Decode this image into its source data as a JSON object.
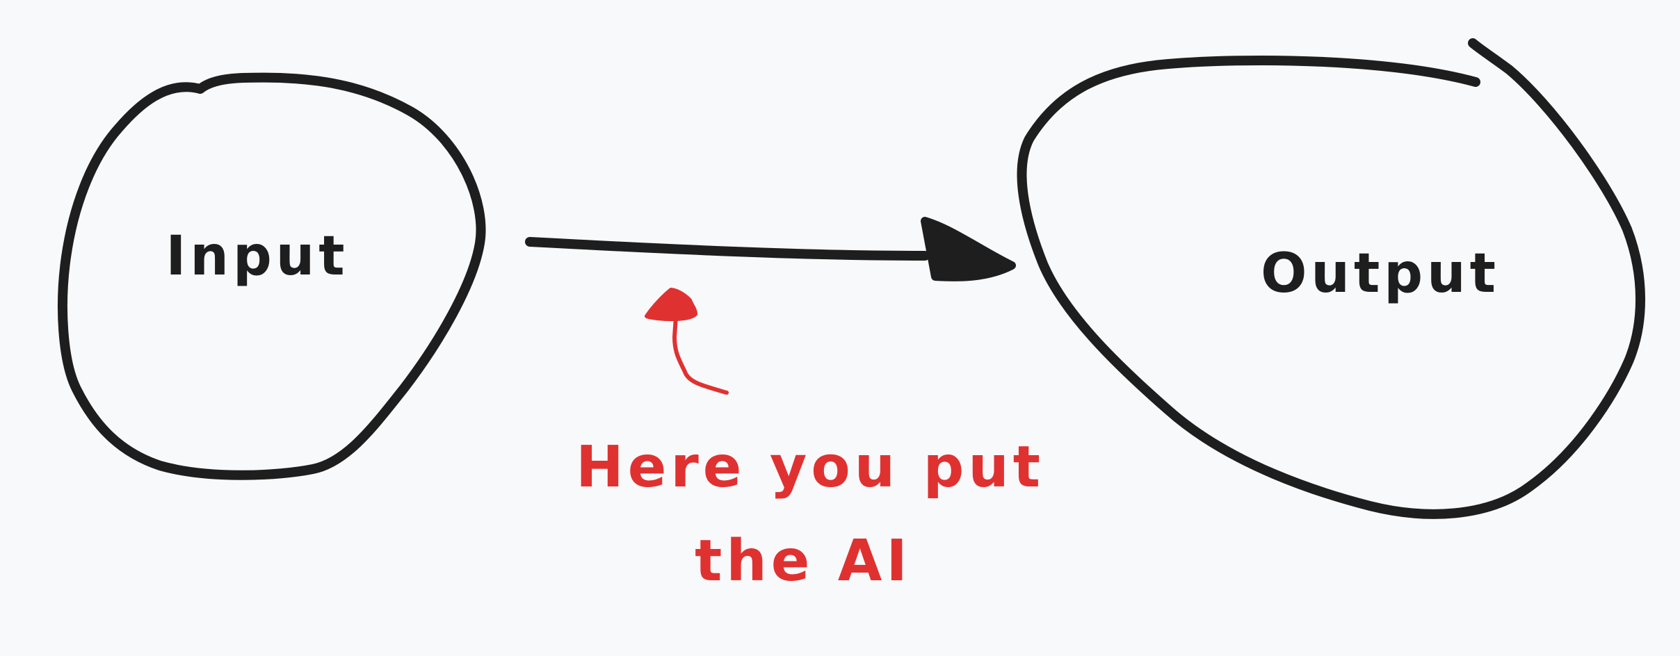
{
  "nodes": {
    "input": {
      "label": "Input"
    },
    "output": {
      "label": "Output"
    }
  },
  "annotation": {
    "line1": "Here you put",
    "line2": "the AI"
  },
  "colors": {
    "background": "#f8f9fb",
    "ink": "#1e1e1e",
    "accent": "#e03131"
  }
}
